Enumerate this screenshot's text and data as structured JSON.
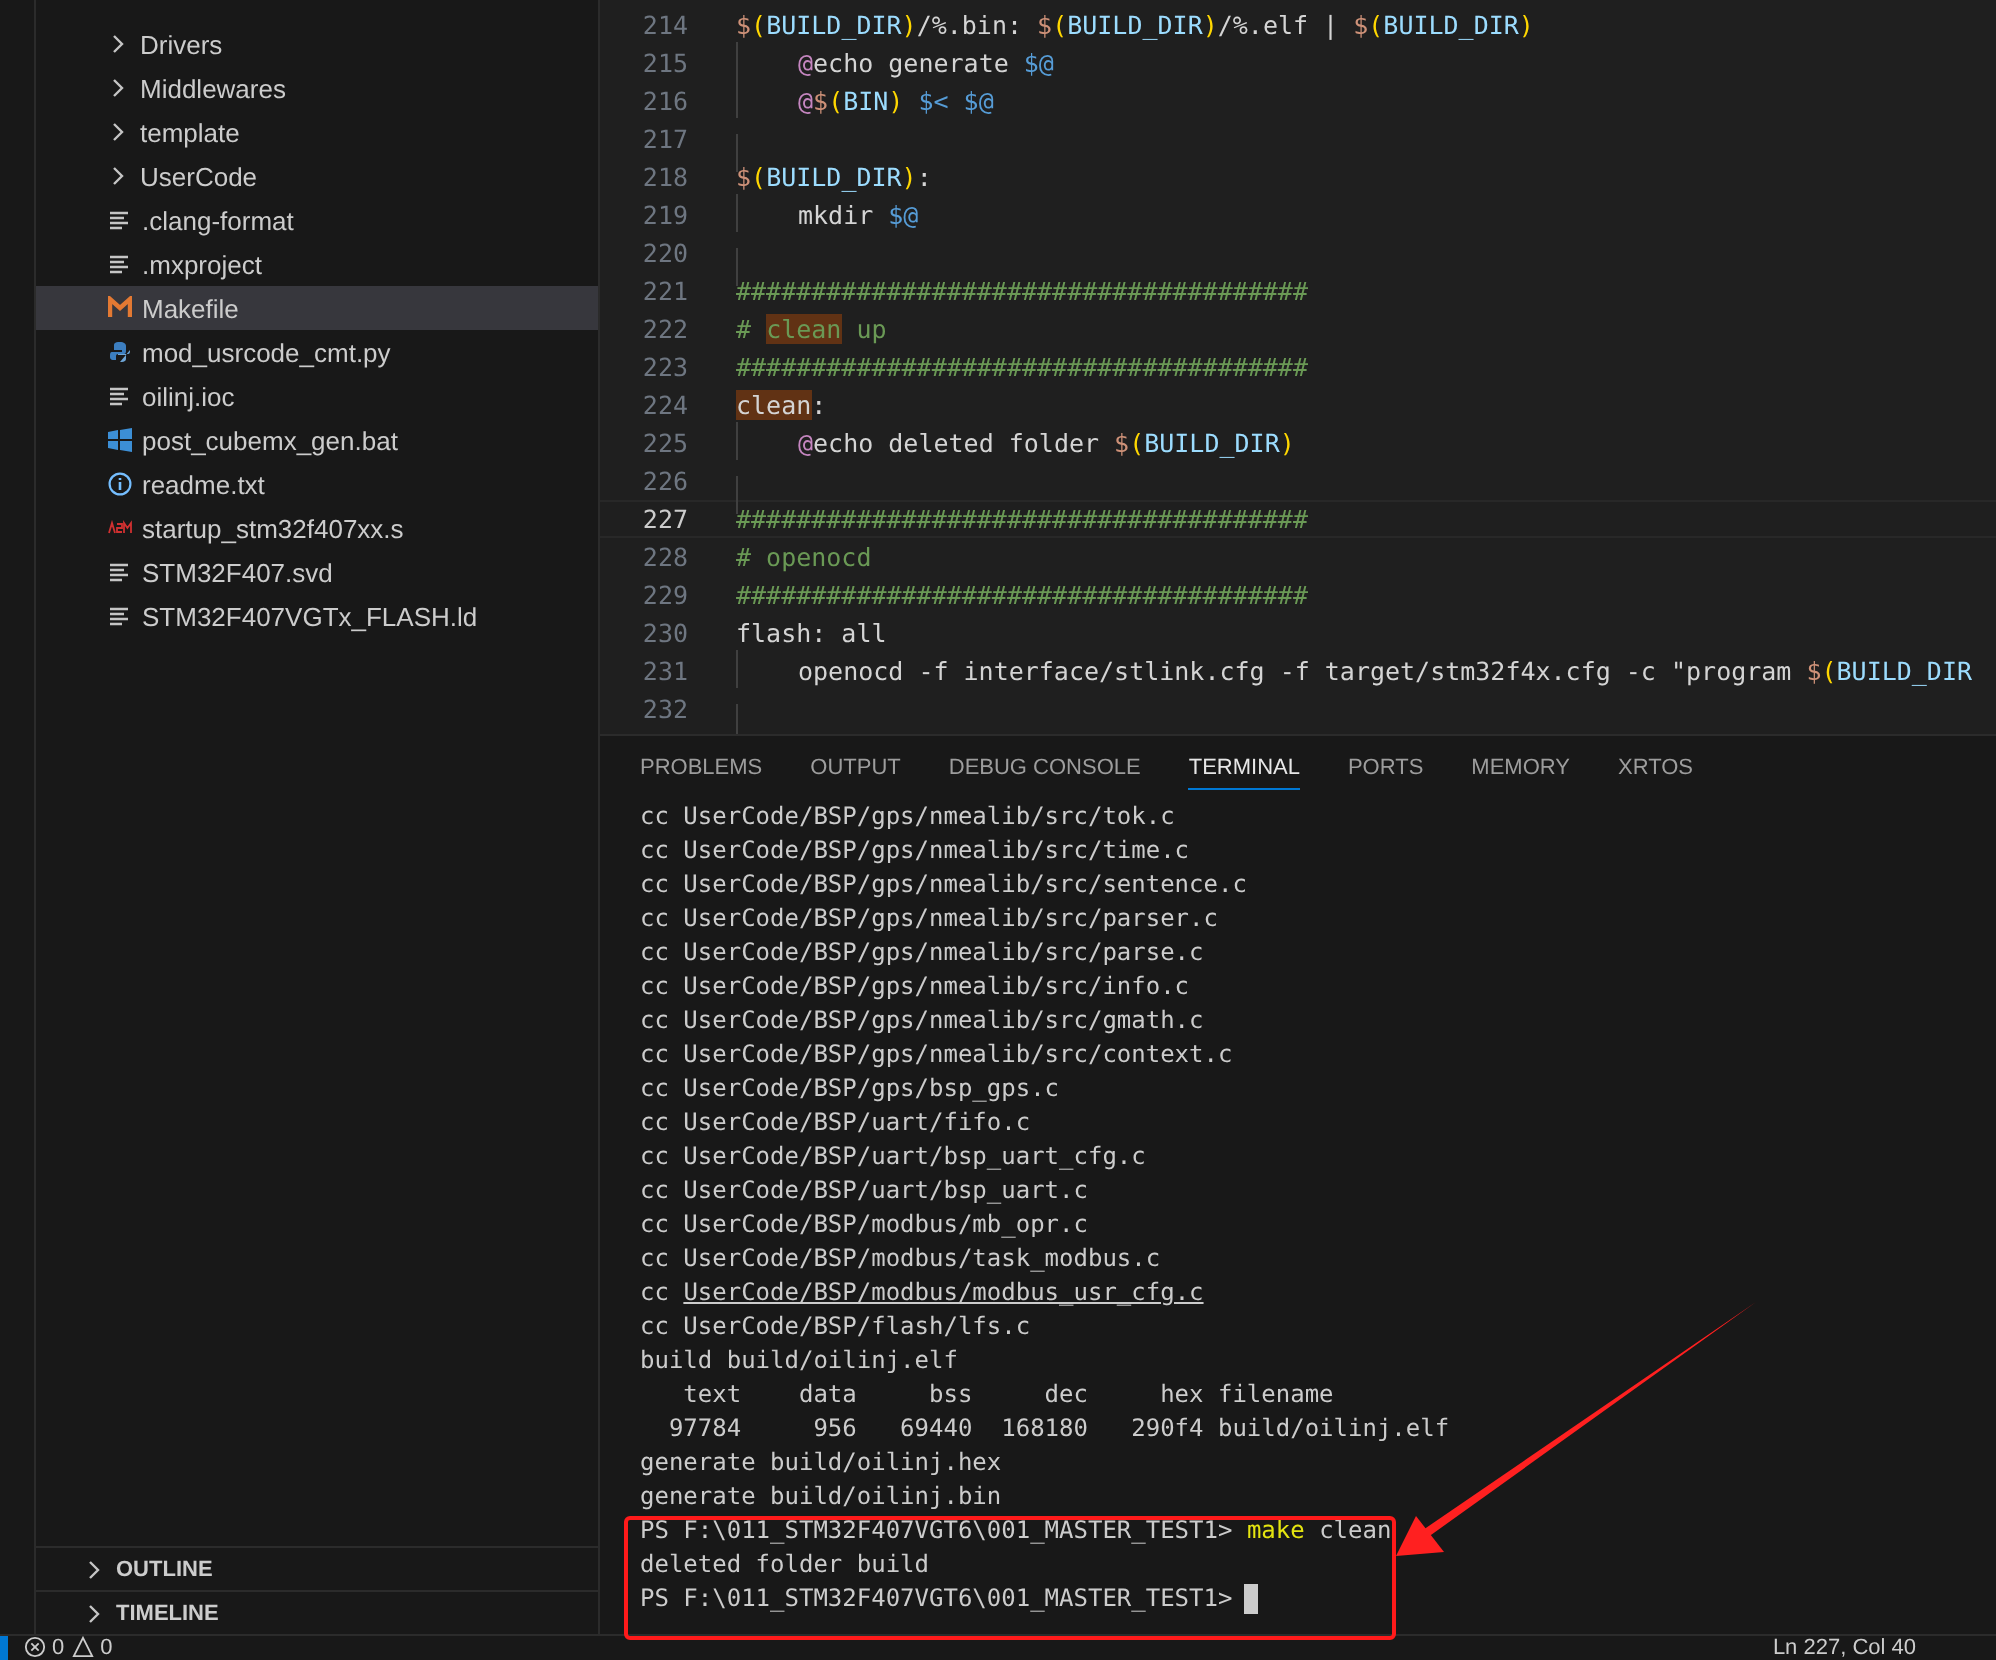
{
  "explorer": {
    "items": [
      {
        "label": "Drivers",
        "kind": "folder",
        "selected": false
      },
      {
        "label": "Middlewares",
        "kind": "folder",
        "selected": false
      },
      {
        "label": "template",
        "kind": "folder",
        "selected": false
      },
      {
        "label": "UserCode",
        "kind": "folder",
        "selected": false
      },
      {
        "label": ".clang-format",
        "kind": "lines",
        "selected": false
      },
      {
        "label": ".mxproject",
        "kind": "lines",
        "selected": false
      },
      {
        "label": "Makefile",
        "kind": "makefile",
        "selected": true
      },
      {
        "label": "mod_usrcode_cmt.py",
        "kind": "python",
        "selected": false
      },
      {
        "label": "oilinj.ioc",
        "kind": "lines",
        "selected": false
      },
      {
        "label": "post_cubemx_gen.bat",
        "kind": "windows",
        "selected": false
      },
      {
        "label": "readme.txt",
        "kind": "info",
        "selected": false
      },
      {
        "label": "startup_stm32f407xx.s",
        "kind": "asm",
        "selected": false
      },
      {
        "label": "STM32F407.svd",
        "kind": "lines",
        "selected": false
      },
      {
        "label": "STM32F407VGTx_FLASH.ld",
        "kind": "lines",
        "selected": false
      }
    ],
    "sections": [
      "OUTLINE",
      "TIMELINE"
    ]
  },
  "editor": {
    "lines": [
      {
        "number": "214",
        "indented": false,
        "current": false,
        "tokens": [
          {
            "t": "$",
            "kind": "dollar"
          },
          {
            "t": "(",
            "kind": "paren"
          },
          {
            "t": "BUILD_DIR",
            "kind": "var"
          },
          {
            "t": ")",
            "kind": "paren"
          },
          {
            "t": "/%.bin: ",
            "kind": "plain"
          },
          {
            "t": "$",
            "kind": "dollar"
          },
          {
            "t": "(",
            "kind": "paren"
          },
          {
            "t": "BUILD_DIR",
            "kind": "var"
          },
          {
            "t": ")",
            "kind": "paren"
          },
          {
            "t": "/%.elf | ",
            "kind": "plain"
          },
          {
            "t": "$",
            "kind": "dollar"
          },
          {
            "t": "(",
            "kind": "paren"
          },
          {
            "t": "BUILD_DIR",
            "kind": "var"
          },
          {
            "t": ")",
            "kind": "paren"
          }
        ]
      },
      {
        "number": "215",
        "indented": true,
        "current": false,
        "tokens": [
          {
            "t": "@",
            "kind": "at"
          },
          {
            "t": "echo generate ",
            "kind": "plain"
          },
          {
            "t": "$@",
            "kind": "auto"
          }
        ]
      },
      {
        "number": "216",
        "indented": true,
        "current": false,
        "tokens": [
          {
            "t": "@",
            "kind": "at"
          },
          {
            "t": "$",
            "kind": "dollar"
          },
          {
            "t": "(",
            "kind": "paren"
          },
          {
            "t": "BIN",
            "kind": "var"
          },
          {
            "t": ")",
            "kind": "paren"
          },
          {
            "t": " $<",
            "kind": "auto"
          },
          {
            "t": " $@",
            "kind": "auto"
          }
        ]
      },
      {
        "number": "217",
        "indented": true,
        "current": false
      },
      {
        "number": "218",
        "indented": false,
        "current": false,
        "tokens": [
          {
            "t": "$",
            "kind": "dollar"
          },
          {
            "t": "(",
            "kind": "paren"
          },
          {
            "t": "BUILD_DIR",
            "kind": "var"
          },
          {
            "t": ")",
            "kind": "paren"
          },
          {
            "t": ":",
            "kind": "plain"
          }
        ]
      },
      {
        "number": "219",
        "indented": true,
        "current": false,
        "tokens": [
          {
            "t": "mkdir ",
            "kind": "plain"
          },
          {
            "t": "$@",
            "kind": "auto"
          }
        ]
      },
      {
        "number": "220",
        "indented": true,
        "current": false
      },
      {
        "number": "221",
        "indented": false,
        "current": false,
        "tokens": [
          {
            "t": "######################################",
            "kind": "comment"
          }
        ]
      },
      {
        "number": "222",
        "indented": false,
        "current": false,
        "tokens": [
          {
            "t": "# ",
            "kind": "comment"
          },
          {
            "t": "clean",
            "kind": "comment",
            "highlighted": true
          },
          {
            "t": " up",
            "kind": "comment"
          }
        ]
      },
      {
        "number": "223",
        "indented": false,
        "current": false,
        "tokens": [
          {
            "t": "######################################",
            "kind": "comment"
          }
        ]
      },
      {
        "number": "224",
        "indented": false,
        "current": false,
        "tokens": [
          {
            "t": "clean",
            "kind": "plain",
            "highlighted": true
          },
          {
            "t": ":",
            "kind": "plain"
          }
        ]
      },
      {
        "number": "225",
        "indented": true,
        "current": false,
        "tokens": [
          {
            "t": "@",
            "kind": "at"
          },
          {
            "t": "echo deleted folder ",
            "kind": "plain"
          },
          {
            "t": "$",
            "kind": "dollar"
          },
          {
            "t": "(",
            "kind": "paren"
          },
          {
            "t": "BUILD_DIR",
            "kind": "var"
          },
          {
            "t": ")",
            "kind": "paren"
          }
        ]
      },
      {
        "number": "226",
        "indented": true,
        "current": false
      },
      {
        "number": "227",
        "indented": false,
        "current": true,
        "tokens": [
          {
            "t": "######################################",
            "kind": "comment"
          }
        ]
      },
      {
        "number": "228",
        "indented": false,
        "current": false,
        "tokens": [
          {
            "t": "# openocd",
            "kind": "comment"
          }
        ]
      },
      {
        "number": "229",
        "indented": false,
        "current": false,
        "tokens": [
          {
            "t": "######################################",
            "kind": "comment"
          }
        ]
      },
      {
        "number": "230",
        "indented": false,
        "current": false,
        "tokens": [
          {
            "t": "flash: all",
            "kind": "plain"
          }
        ]
      },
      {
        "number": "231",
        "indented": true,
        "current": false,
        "tokens": [
          {
            "t": "openocd -f interface/stlink.cfg -f target/stm32f4x.cfg -c \"program ",
            "kind": "plain"
          },
          {
            "t": "$",
            "kind": "dollar"
          },
          {
            "t": "(",
            "kind": "paren"
          },
          {
            "t": "BUILD_DIR",
            "kind": "var"
          }
        ]
      },
      {
        "number": "232",
        "indented": true,
        "current": false
      }
    ]
  },
  "panel": {
    "tabs": [
      {
        "label": "PROBLEMS",
        "selected": false
      },
      {
        "label": "OUTPUT",
        "selected": false
      },
      {
        "label": "DEBUG CONSOLE",
        "selected": false
      },
      {
        "label": "TERMINAL",
        "selected": true
      },
      {
        "label": "PORTS",
        "selected": false
      },
      {
        "label": "MEMORY",
        "selected": false
      },
      {
        "label": "XRTOS",
        "selected": false
      }
    ],
    "terminal": [
      {
        "kind": "output",
        "text": "cc UserCode/BSP/gps/nmealib/src/tok.c"
      },
      {
        "kind": "output",
        "text": "cc UserCode/BSP/gps/nmealib/src/time.c"
      },
      {
        "kind": "output",
        "text": "cc UserCode/BSP/gps/nmealib/src/sentence.c"
      },
      {
        "kind": "output",
        "text": "cc UserCode/BSP/gps/nmealib/src/parser.c"
      },
      {
        "kind": "output",
        "text": "cc UserCode/BSP/gps/nmealib/src/parse.c"
      },
      {
        "kind": "output",
        "text": "cc UserCode/BSP/gps/nmealib/src/info.c"
      },
      {
        "kind": "output",
        "text": "cc UserCode/BSP/gps/nmealib/src/gmath.c"
      },
      {
        "kind": "output",
        "text": "cc UserCode/BSP/gps/nmealib/src/context.c"
      },
      {
        "kind": "output",
        "text": "cc UserCode/BSP/gps/bsp_gps.c"
      },
      {
        "kind": "output",
        "text": "cc UserCode/BSP/uart/fifo.c"
      },
      {
        "kind": "output",
        "text": "cc UserCode/BSP/uart/bsp_uart_cfg.c"
      },
      {
        "kind": "output",
        "text": "cc UserCode/BSP/uart/bsp_uart.c"
      },
      {
        "kind": "output",
        "text": "cc UserCode/BSP/modbus/mb_opr.c"
      },
      {
        "kind": "output",
        "text": "cc UserCode/BSP/modbus/task_modbus.c"
      },
      {
        "kind": "link",
        "text": "cc ",
        "link": "UserCode/BSP/modbus/modbus_usr_cfg.c"
      },
      {
        "kind": "output",
        "text": "cc UserCode/BSP/flash/lfs.c"
      },
      {
        "kind": "output",
        "text": "build build/oilinj.elf"
      },
      {
        "kind": "output",
        "text": "   text    data     bss     dec     hex filename"
      },
      {
        "kind": "output",
        "text": "  97784     956   69440  168180   290f4 build/oilinj.elf"
      },
      {
        "kind": "output",
        "text": "generate build/oilinj.hex"
      },
      {
        "kind": "output",
        "text": "generate build/oilinj.bin"
      },
      {
        "kind": "prompt",
        "prompt": "PS F:\\011_STM32F407VGT6\\001_MASTER_TEST1>",
        "command": "make",
        "args": "clean"
      },
      {
        "kind": "output",
        "text": "deleted folder build"
      },
      {
        "kind": "prompt",
        "prompt": "PS F:\\011_STM32F407VGT6\\001_MASTER_TEST1>",
        "cursor": true
      }
    ]
  },
  "status_bar": {
    "errors": "0",
    "warnings": "0",
    "position": "Ln 227, Col 40"
  }
}
